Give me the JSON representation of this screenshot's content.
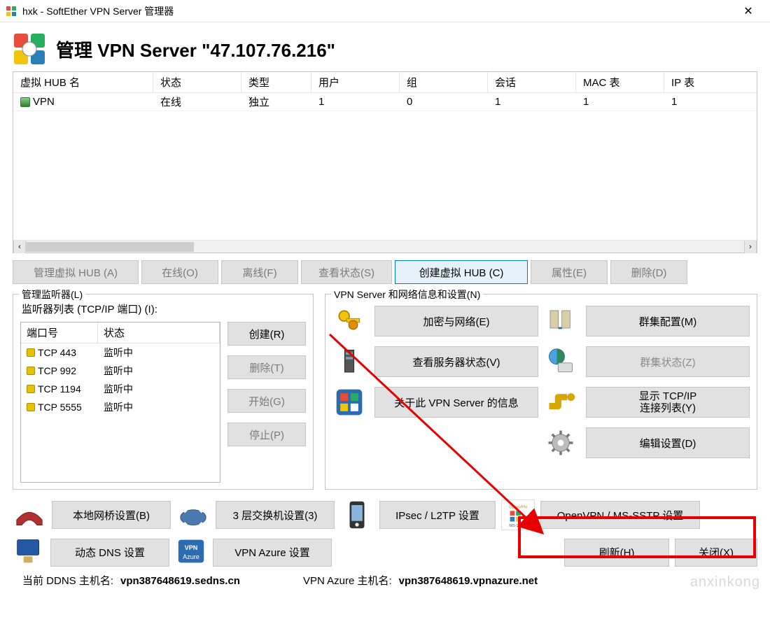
{
  "window": {
    "title": "hxk - SoftEther VPN Server 管理器",
    "close_glyph": "✕"
  },
  "header": {
    "title": "管理 VPN Server \"47.107.76.216\""
  },
  "hub_table": {
    "columns": [
      "虚拟 HUB 名",
      "状态",
      "类型",
      "用户",
      "组",
      "会话",
      "MAC 表",
      "IP 表"
    ],
    "rows": [
      {
        "name": "VPN",
        "status": "在线",
        "type": "独立",
        "users": "1",
        "groups": "0",
        "sessions": "1",
        "mac": "1",
        "ip": "1"
      }
    ]
  },
  "hub_buttons": {
    "manage": "管理虚拟 HUB (A)",
    "online": "在线(O)",
    "offline": "离线(F)",
    "status": "查看状态(S)",
    "create": "创建虚拟 HUB (C)",
    "properties": "属性(E)",
    "delete": "删除(D)"
  },
  "listener": {
    "legend": "管理监听器(L)",
    "list_label": "监听器列表 (TCP/IP 端口) (I):",
    "columns": [
      "端口号",
      "状态"
    ],
    "rows": [
      {
        "port": "TCP 443",
        "status": "监听中"
      },
      {
        "port": "TCP 992",
        "status": "监听中"
      },
      {
        "port": "TCP 1194",
        "status": "监听中"
      },
      {
        "port": "TCP 5555",
        "status": "监听中"
      }
    ],
    "buttons": {
      "create": "创建(R)",
      "delete": "删除(T)",
      "start": "开始(G)",
      "stop": "停止(P)"
    }
  },
  "server_settings": {
    "legend": "VPN Server 和网络信息和设置(N)",
    "encryption": "加密与网络(E)",
    "cluster_config": "群集配置(M)",
    "server_status": "查看服务器状态(V)",
    "cluster_status": "群集状态(Z)",
    "about": "关于此 VPN Server 的信息",
    "tcpip_conn": "显示 TCP/IP\n连接列表(Y)",
    "edit_config": "编辑设置(D)"
  },
  "bottom": {
    "local_bridge": "本地网桥设置(B)",
    "l3_switch": "3 层交换机设置(3)",
    "ipsec": "IPsec / L2TP 设置",
    "openvpn": "OpenVPN / MS-SSTP 设置",
    "ddns": "动态 DNS 设置",
    "azure": "VPN Azure 设置",
    "refresh": "刷新(H)",
    "close": "关闭(X)"
  },
  "status_bar": {
    "ddns_label": "当前 DDNS 主机名:",
    "ddns_value": "vpn387648619.sedns.cn",
    "azure_label": "VPN Azure 主机名:",
    "azure_value": "vpn387648619.vpnazure.net"
  },
  "watermark": "anxinkong"
}
